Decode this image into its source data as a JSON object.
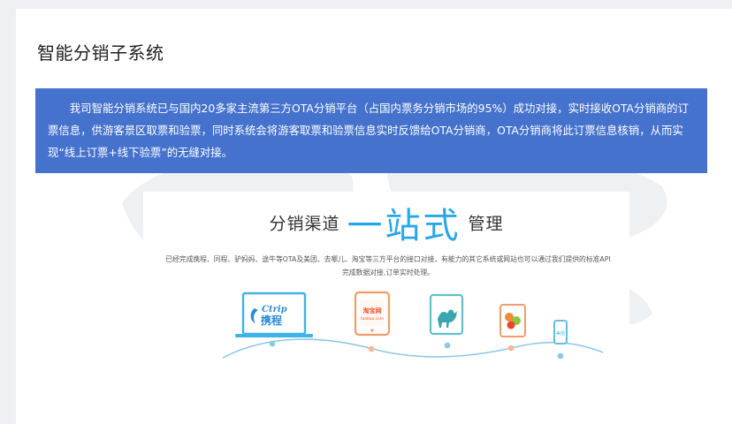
{
  "page": {
    "title": "智能分销子系统"
  },
  "intro": {
    "text": "我司智能分销系统已与国内20多家主流第三方OTA分销平台（占国内票务分销市场的95%）成功对接，实时接收OTA分销商的订票信息，供游客景区取票和验票，同时系统会将游客取票和验票信息实时反馈给OTA分销商，OTA分销商将此订票信息核销，从而实现“线上订票+线下验票”的无缝对接。"
  },
  "promo": {
    "headline_left": "分销渠道",
    "headline_big": "一站式",
    "headline_right": "管理",
    "description": "已经完成携程、同程、驴妈妈、途牛等OTA及美团、去哪儿、淘宝等三方平台的接口对接，有能力的其它系统或网站也可以通过我们提供的标准API完成数据对接,订单实时处理。",
    "logos": {
      "ctrip_en": "Ctrip",
      "ctrip_cn": "携程",
      "taobao_cn": "淘宝网",
      "taobao_en": "taobao.com",
      "meituan": "美团"
    }
  },
  "colors": {
    "banner": "#4572cc",
    "accent": "#27a7e8",
    "curve_line": "#8ec8e6"
  }
}
